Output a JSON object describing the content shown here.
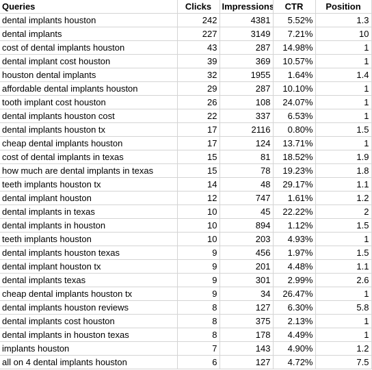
{
  "headers": [
    "Queries",
    "Clicks",
    "Impressions",
    "CTR",
    "Position"
  ],
  "rows": [
    [
      "dental implants houston",
      "242",
      "4381",
      "5.52%",
      "1.3"
    ],
    [
      "dental implants",
      "227",
      "3149",
      "7.21%",
      "10"
    ],
    [
      "cost of dental implants houston",
      "43",
      "287",
      "14.98%",
      "1"
    ],
    [
      "dental implant cost houston",
      "39",
      "369",
      "10.57%",
      "1"
    ],
    [
      "houston dental implants",
      "32",
      "1955",
      "1.64%",
      "1.4"
    ],
    [
      "affordable dental implants houston",
      "29",
      "287",
      "10.10%",
      "1"
    ],
    [
      "tooth implant cost houston",
      "26",
      "108",
      "24.07%",
      "1"
    ],
    [
      "dental implants houston cost",
      "22",
      "337",
      "6.53%",
      "1"
    ],
    [
      "dental implants houston tx",
      "17",
      "2116",
      "0.80%",
      "1.5"
    ],
    [
      "cheap dental implants houston",
      "17",
      "124",
      "13.71%",
      "1"
    ],
    [
      "cost of dental implants in texas",
      "15",
      "81",
      "18.52%",
      "1.9"
    ],
    [
      "how much are dental implants in texas",
      "15",
      "78",
      "19.23%",
      "1.8"
    ],
    [
      "teeth implants houston tx",
      "14",
      "48",
      "29.17%",
      "1.1"
    ],
    [
      "dental implant houston",
      "12",
      "747",
      "1.61%",
      "1.2"
    ],
    [
      "dental implants in texas",
      "10",
      "45",
      "22.22%",
      "2"
    ],
    [
      "dental implants in houston",
      "10",
      "894",
      "1.12%",
      "1.5"
    ],
    [
      "teeth implants houston",
      "10",
      "203",
      "4.93%",
      "1"
    ],
    [
      "dental implants houston texas",
      "9",
      "456",
      "1.97%",
      "1.5"
    ],
    [
      "dental implant houston tx",
      "9",
      "201",
      "4.48%",
      "1.1"
    ],
    [
      "dental implants texas",
      "9",
      "301",
      "2.99%",
      "2.6"
    ],
    [
      "cheap dental implants houston tx",
      "9",
      "34",
      "26.47%",
      "1"
    ],
    [
      "dental implants houston reviews",
      "8",
      "127",
      "6.30%",
      "5.8"
    ],
    [
      "dental implants cost houston",
      "8",
      "375",
      "2.13%",
      "1"
    ],
    [
      "dental implants in houston texas",
      "8",
      "178",
      "4.49%",
      "1"
    ],
    [
      "implants houston",
      "7",
      "143",
      "4.90%",
      "1.2"
    ],
    [
      "all on 4 dental implants houston",
      "6",
      "127",
      "4.72%",
      "7.5"
    ]
  ]
}
